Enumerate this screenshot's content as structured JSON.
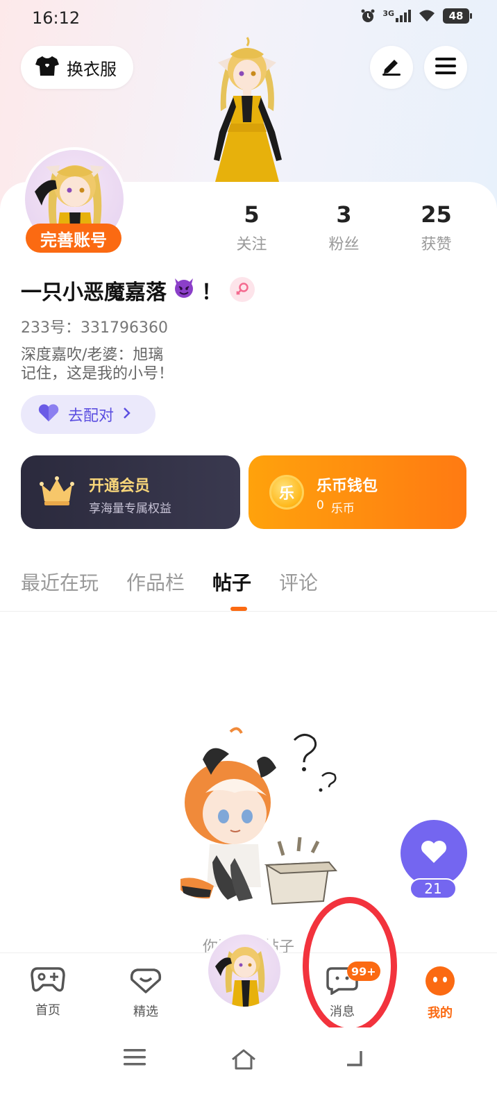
{
  "status_bar": {
    "time": "16:12",
    "network": "3G",
    "battery": "48"
  },
  "header": {
    "outfit_label": "换衣服",
    "outfit_icon": "shirt-icon",
    "edit_icon": "edit-icon",
    "menu_icon": "menu-icon"
  },
  "profile": {
    "complete_account_label": "完善账号",
    "stats": [
      {
        "value": "5",
        "label": "关注"
      },
      {
        "value": "3",
        "label": "粉丝"
      },
      {
        "value": "25",
        "label": "获赞"
      }
    ],
    "nickname": "一只小恶魔嘉落",
    "nickname_suffix": "！",
    "uid": "233号：331796360",
    "bio_line1": "深度嘉吹/老婆：旭璃",
    "bio_line2": "记住，这是我的小号！",
    "match_label": "去配对"
  },
  "cards": {
    "vip": {
      "title": "开通会员",
      "subtitle": "享海量专属权益"
    },
    "wallet": {
      "title": "乐币钱包",
      "amount": "0",
      "unit": "乐币",
      "coin_char": "乐"
    }
  },
  "tabs": [
    {
      "label": "最近在玩",
      "active": false
    },
    {
      "label": "作品栏",
      "active": false
    },
    {
      "label": "帖子",
      "active": true
    },
    {
      "label": "评论",
      "active": false
    }
  ],
  "empty_state": {
    "text": "你还没有帖子"
  },
  "like_fab": {
    "count": "21"
  },
  "bottom_nav": [
    {
      "label": "首页",
      "icon": "gamepad-icon"
    },
    {
      "label": "精选",
      "icon": "heart-box-icon"
    },
    {
      "label": "消息",
      "icon": "chat-icon",
      "badge": "99+"
    },
    {
      "label": "我的",
      "icon": "face-icon",
      "active": true
    }
  ],
  "colors": {
    "accent": "#fb6a12",
    "purple": "#7466f0",
    "annotation": "#f2333d"
  }
}
